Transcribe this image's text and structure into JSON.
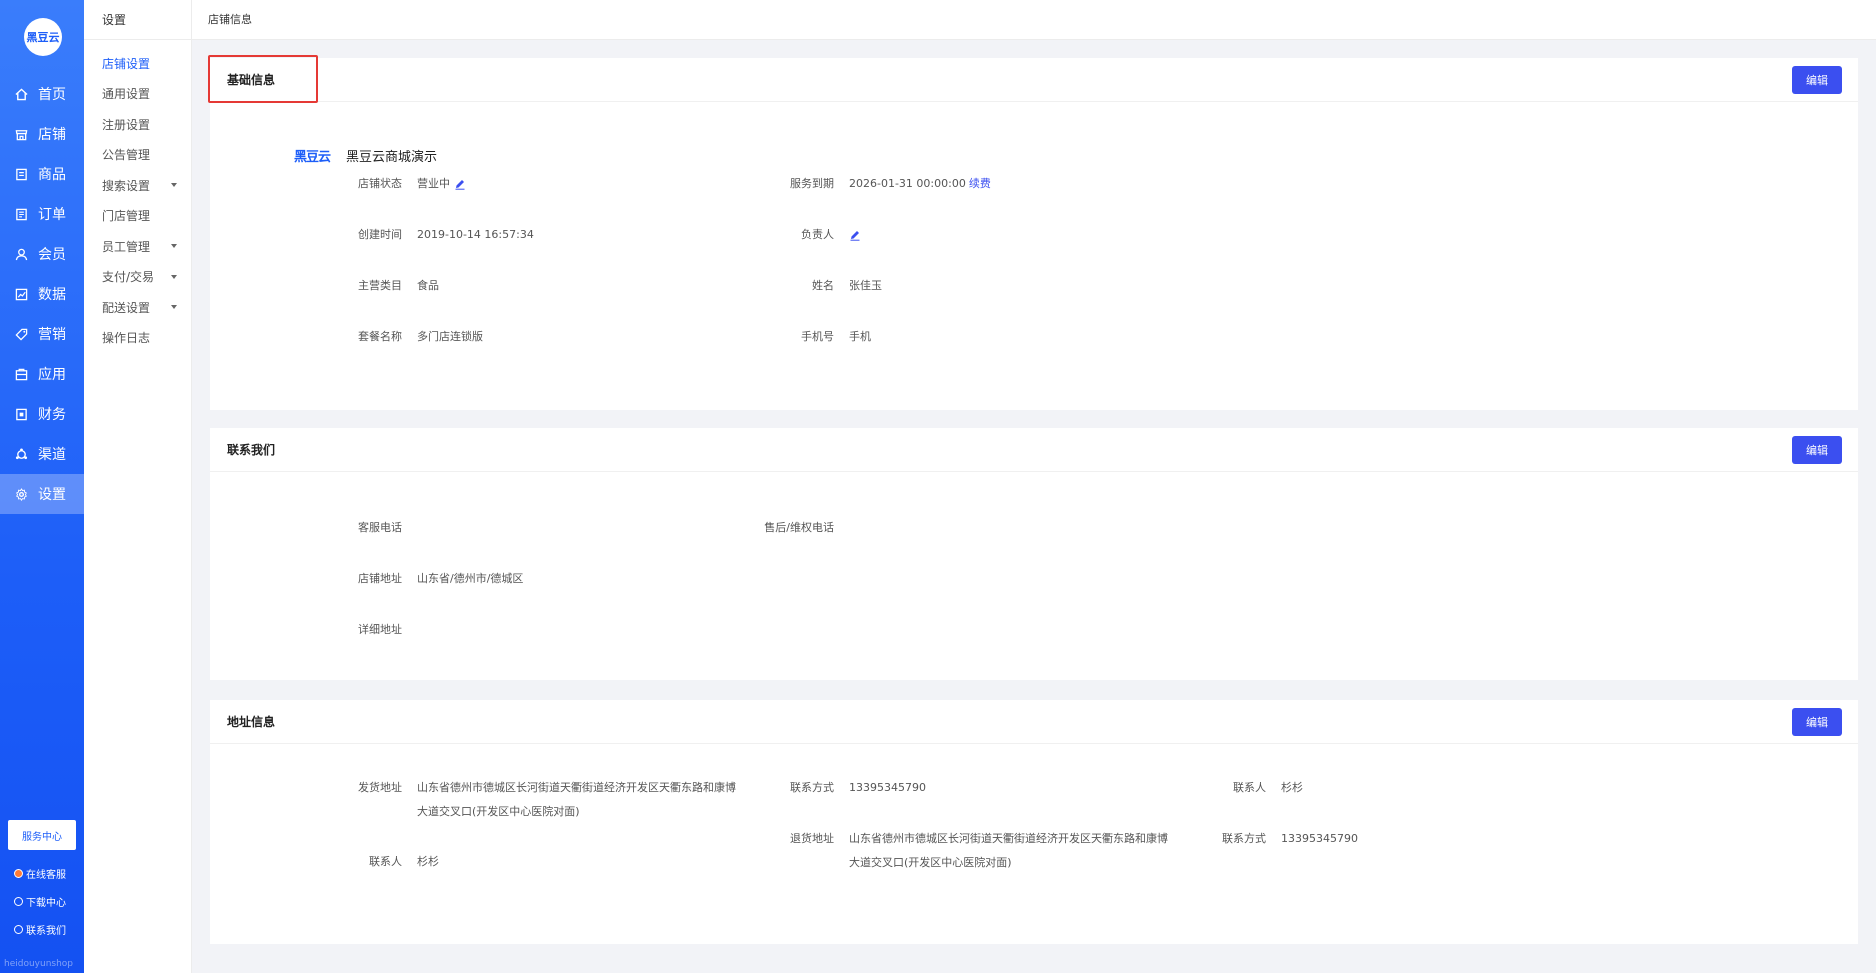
{
  "sidebar": {
    "logo_text": "黑豆云",
    "items": [
      {
        "label": "首页",
        "icon": "home-icon"
      },
      {
        "label": "店铺",
        "icon": "store-icon"
      },
      {
        "label": "商品",
        "icon": "goods-icon"
      },
      {
        "label": "订单",
        "icon": "order-icon"
      },
      {
        "label": "会员",
        "icon": "member-icon"
      },
      {
        "label": "数据",
        "icon": "chart-icon"
      },
      {
        "label": "营销",
        "icon": "tag-icon"
      },
      {
        "label": "应用",
        "icon": "app-icon"
      },
      {
        "label": "财务",
        "icon": "finance-icon"
      },
      {
        "label": "渠道",
        "icon": "channel-icon"
      },
      {
        "label": "设置",
        "icon": "gear-icon"
      }
    ],
    "service_center": "服务中心",
    "online_service": "在线客服",
    "download_center": "下载中心",
    "contact_us": "联系我们",
    "watermark": "heidouyunshop"
  },
  "submenu": {
    "title": "设置",
    "items": [
      "店铺设置",
      "通用设置",
      "注册设置",
      "公告管理",
      "搜索设置",
      "门店管理",
      "员工管理",
      "支付/交易",
      "配送设置",
      "操作日志"
    ]
  },
  "breadcrumb": "店铺信息",
  "edit_label": "编辑",
  "basic": {
    "title": "基础信息",
    "brand_logo": "黑豆云",
    "shop_name": "黑豆云商城演示",
    "status_label": "店铺状态",
    "status_value": "营业中",
    "created_label": "创建时间",
    "created_value": "2019-10-14 16:57:34",
    "category_label": "主营类目",
    "category_value": "食品",
    "plan_label": "套餐名称",
    "plan_value": "多门店连锁版",
    "expire_label": "服务到期",
    "expire_value": "2026-01-31 00:00:00",
    "renew_link": "续费",
    "owner_label": "负责人",
    "name_label": "姓名",
    "name_value": "张佳玉",
    "phone_label": "手机号",
    "phone_value": "手机"
  },
  "contact": {
    "title": "联系我们",
    "service_phone_label": "客服电话",
    "aftersale_label": "售后/维权电话",
    "address_label": "店铺地址",
    "address_value": "山东省/德州市/德城区",
    "detail_label": "详细地址"
  },
  "address": {
    "title": "地址信息",
    "ship_label": "发货地址",
    "ship_value_line1": "山东省德州市德城区长河街道天衢街道经济开发区天衢东路和康博",
    "ship_value_line2": "大道交叉口(开发区中心医院对面)",
    "ship_contact_label": "联系人",
    "ship_contact_value": "杉杉",
    "ship_phone_label": "联系方式",
    "ship_phone_value": "13395345790",
    "ret_label": "退货地址",
    "ret_value_line1": "山东省德州市德城区长河街道天衢街道经济开发区天衢东路和康博",
    "ret_value_line2": "大道交叉口(开发区中心医院对面)",
    "contact_label": "联系人",
    "contact_value": "杉杉",
    "ret_phone_label": "联系方式",
    "ret_phone_value": "13395345790"
  },
  "colors": {
    "primary": "#1d5ef8",
    "button": "#3b4ff0",
    "highlight": "#e53935"
  }
}
